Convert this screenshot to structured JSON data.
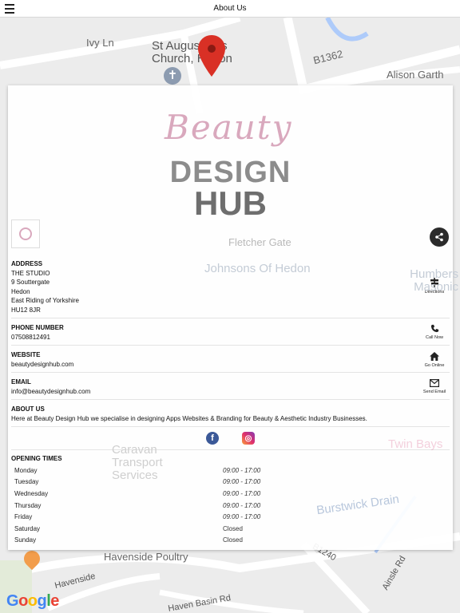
{
  "topbar": {
    "title": "About Us"
  },
  "map": {
    "labels": {
      "ivy_lane": "Ivy Ln",
      "church": "St Augustine's Church, Hedon",
      "b1362": "B1362",
      "alison_garth": "Alison Garth",
      "fletcher_gate": "Fletcher Gate",
      "johnsons": "Johnsons Of Hedon",
      "humbers_masonic": "Humbers Masonic",
      "caravan_transport": "Caravan Transport Services",
      "twin_bays": "Twin Bays",
      "burstwick_drain": "Burstwick Drain",
      "havenside_poultry": "Havenside Poultry",
      "havenside": "Havenside",
      "b1240": "B1240",
      "ainsle": "Ainsle Rd",
      "haven_basin": "Haven Basin Rd"
    },
    "pin_color": "#d93025",
    "attribution": "Google"
  },
  "logo": {
    "script": "Beauty",
    "line1": "DESIGN",
    "line2": "HUB"
  },
  "address": {
    "heading": "ADDRESS",
    "lines": [
      "THE STUDIO",
      "9 Souttergate",
      "Hedon",
      "East Riding of Yorkshire",
      "HU12 8JR"
    ],
    "action": "Directions"
  },
  "phone": {
    "heading": "PHONE NUMBER",
    "value": "07508812491",
    "action": "Call Now"
  },
  "website": {
    "heading": "WEBSITE",
    "value": "beautydesignhub.com",
    "action": "Go Online"
  },
  "email": {
    "heading": "EMAIL",
    "value": "info@beautydesignhub.com",
    "action": "Send Email"
  },
  "about": {
    "heading": "ABOUT US",
    "text": "Here at Beauty Design Hub we specialise in designing Apps Websites & Branding for Beauty & Aesthetic Industry Businesses."
  },
  "social": {
    "facebook": "f",
    "instagram": "◎"
  },
  "opening": {
    "heading": "OPENING TIMES",
    "days": [
      {
        "day": "Monday",
        "time": "09:00 - 17:00"
      },
      {
        "day": "Tuesday",
        "time": "09:00 - 17:00"
      },
      {
        "day": "Wednesday",
        "time": "09:00 - 17:00"
      },
      {
        "day": "Thursday",
        "time": "09:00 - 17:00"
      },
      {
        "day": "Friday",
        "time": "09:00 - 17:00"
      },
      {
        "day": "Saturday",
        "time": "Closed"
      },
      {
        "day": "Sunday",
        "time": "Closed"
      }
    ]
  },
  "colors": {
    "brand_pink": "#d9a8bd",
    "brand_gray": "#7a7a7a",
    "facebook": "#3b5998"
  }
}
